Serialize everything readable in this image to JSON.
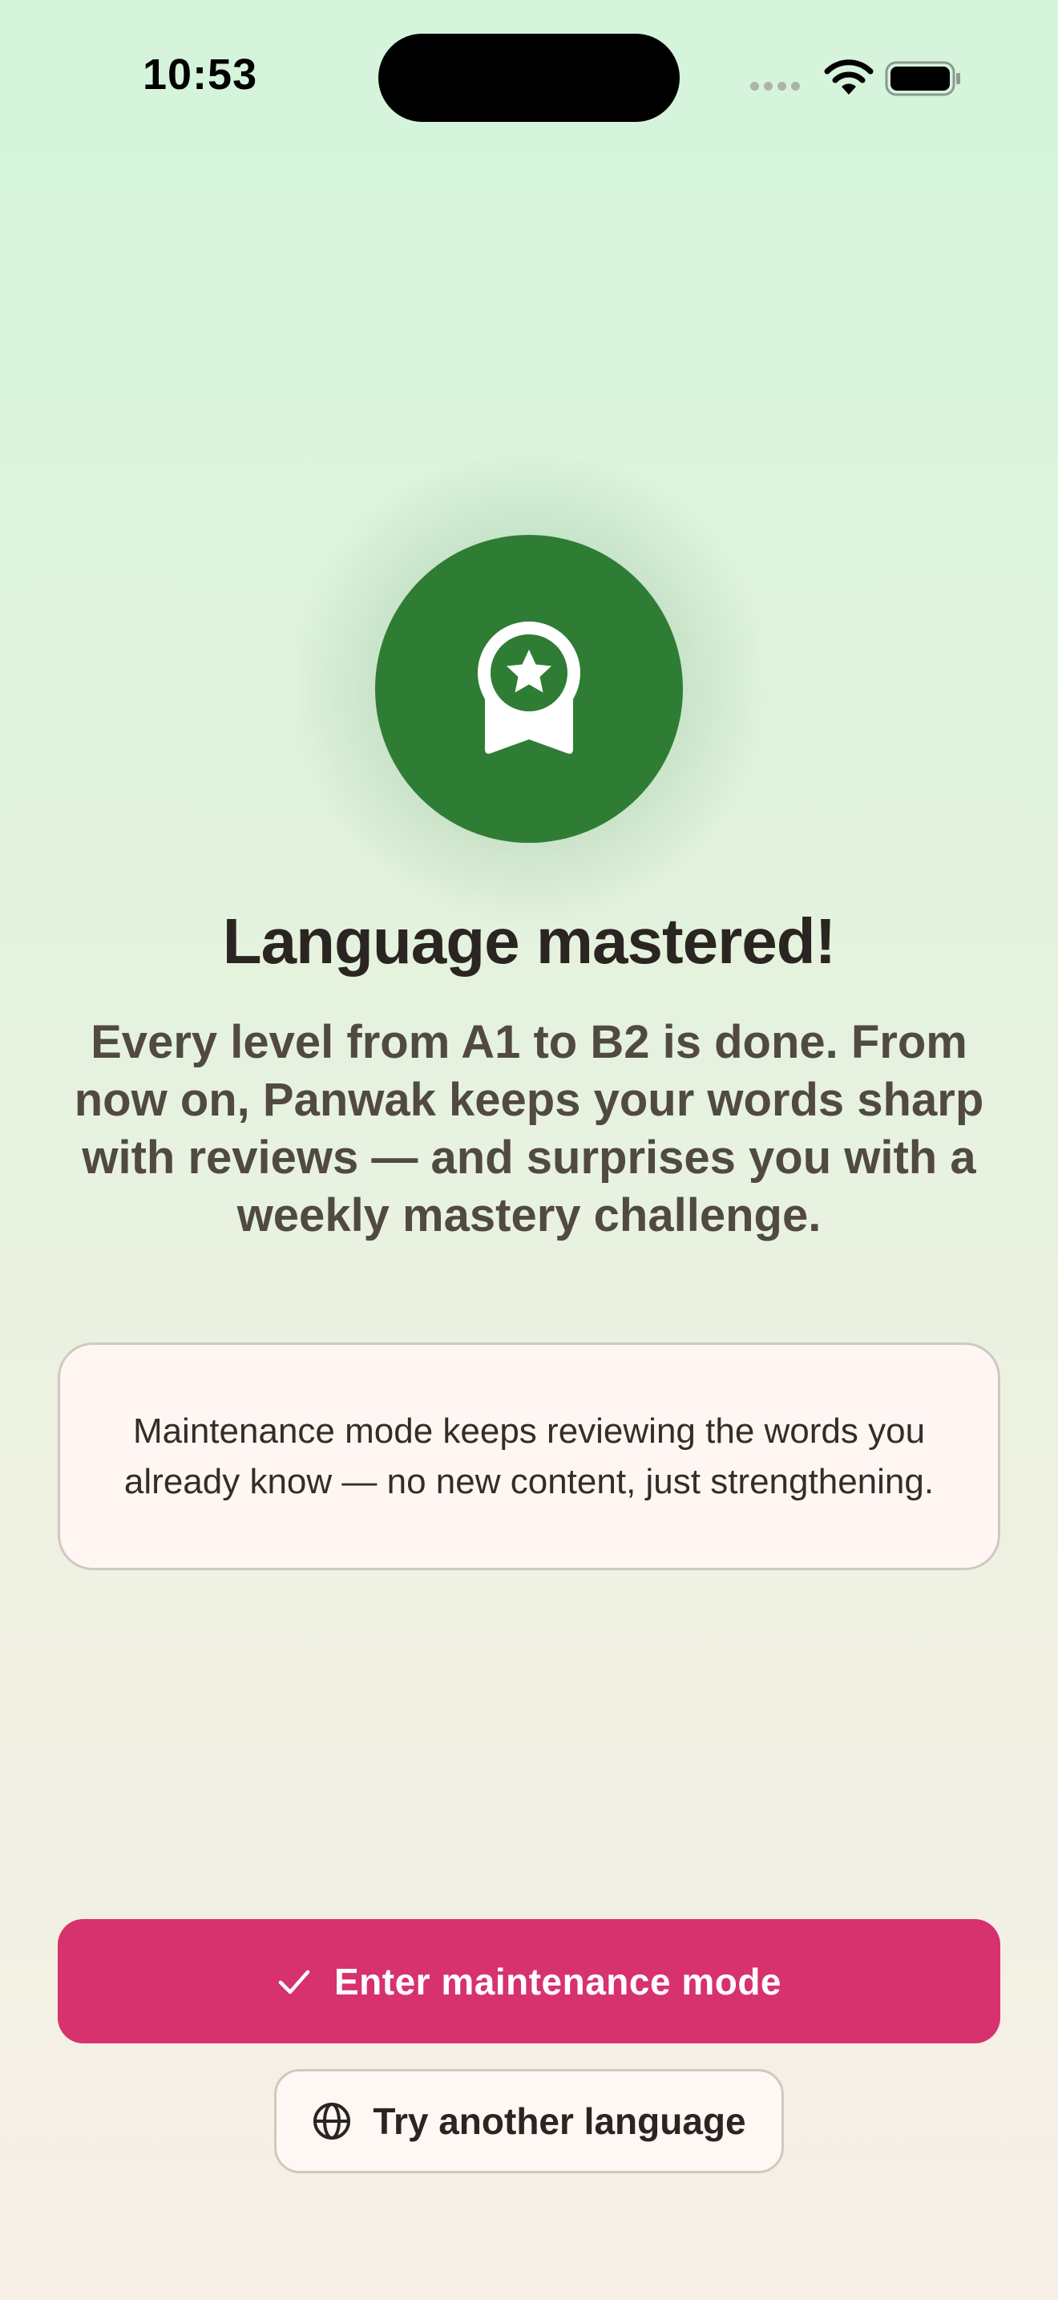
{
  "status_bar": {
    "time": "10:53",
    "icons": [
      "signal-dots-icon",
      "wifi-icon",
      "battery-icon"
    ]
  },
  "badge": {
    "icon": "medal-star-icon",
    "circle_color": "#2f7d34"
  },
  "title": "Language mastered!",
  "subtitle": "Every level from A1 to B2 is done. From now on, Panwak keeps your words sharp with reviews — and surprises you with a weekly mastery challenge.",
  "info_card": {
    "text": "Maintenance mode keeps reviewing the words you already know — no new content, just strengthening."
  },
  "actions": {
    "primary": {
      "label": "Enter maintenance mode",
      "icon": "check-icon",
      "color": "#d7326d"
    },
    "secondary": {
      "label": "Try another language",
      "icon": "globe-icon"
    }
  }
}
